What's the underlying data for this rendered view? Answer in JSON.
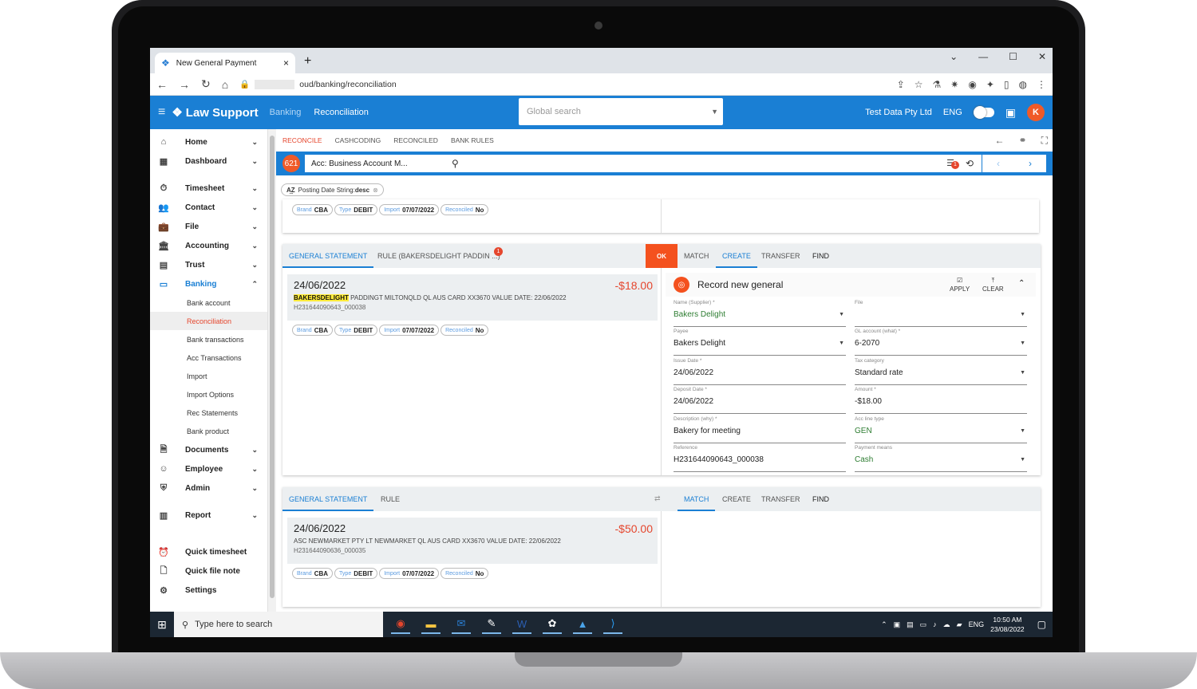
{
  "browser": {
    "tab_title": "New General Payment",
    "tab_close": "×",
    "new_tab": "+",
    "url_suffix": "oud/banking/reconciliation",
    "win_min": "—",
    "win_max": "☐",
    "win_close": "✕",
    "win_menu": "⌄"
  },
  "app": {
    "logo": "Law Support",
    "crumb_1": "Banking",
    "crumb_2": "Reconciliation",
    "global_search_placeholder": "Global search",
    "company": "Test Data Pty Ltd",
    "lang": "ENG",
    "avatar_letter": "K",
    "accent": "#1a7fd4",
    "alert": "#e5462d"
  },
  "sidebar": {
    "items": [
      {
        "label": "Home",
        "icon": "home-icon"
      },
      {
        "label": "Dashboard",
        "icon": "dashboard-icon"
      },
      {
        "label": "Timesheet",
        "icon": "stopwatch-icon"
      },
      {
        "label": "Contact",
        "icon": "people-icon"
      },
      {
        "label": "File",
        "icon": "briefcase-icon"
      },
      {
        "label": "Accounting",
        "icon": "bank-icon"
      },
      {
        "label": "Trust",
        "icon": "building-icon"
      },
      {
        "label": "Banking",
        "icon": "card-icon"
      }
    ],
    "banking_sub": [
      "Bank account",
      "Reconciliation",
      "Bank transactions",
      "Acc Transactions",
      "Import",
      "Import Options",
      "Rec Statements",
      "Bank product"
    ],
    "items_2": [
      {
        "label": "Documents"
      },
      {
        "label": "Employee"
      },
      {
        "label": "Admin"
      },
      {
        "label": "Report"
      },
      {
        "label": "Quick timesheet"
      },
      {
        "label": "Quick file note"
      },
      {
        "label": "Settings"
      }
    ]
  },
  "main": {
    "tabs": [
      "RECONCILE",
      "CASHCODING",
      "RECONCILED",
      "BANK RULES"
    ],
    "count": "621",
    "account": "Acc: Business Account M...",
    "filter_badge": "1",
    "sort_chip": "Posting Date String:",
    "sort_dir": "desc",
    "chips": {
      "brand_k": "Brand",
      "brand_v": "CBA",
      "type_k": "Type",
      "type_v": "DEBIT",
      "import_k": "Import",
      "import_v": "07/07/2022",
      "rec_k": "Reconciled",
      "rec_v": "No"
    },
    "card1": {
      "tab_statement": "GENERAL STATEMENT",
      "tab_rule": "RULE (BAKERSDELIGHT PADDIN ...)",
      "rule_badge": "1",
      "ok": "OK",
      "tab_match": "MATCH",
      "tab_create": "CREATE",
      "tab_transfer": "TRANSFER",
      "tab_find": "FIND",
      "date": "24/06/2022",
      "amount": "-$18.00",
      "highlight": "BAKERSDELIGHT",
      "desc": " PADDINGT MILTONQLD QL AUS CARD XX3670 VALUE DATE: 22/06/2022",
      "ref": "H231644090643_000038"
    },
    "form": {
      "title": "Record new general",
      "apply": "APPLY",
      "clear": "CLEAR",
      "fields": [
        {
          "label": "Name (Supplier) *",
          "value": "Bakers Delight"
        },
        {
          "label": "File",
          "value": ""
        },
        {
          "label": "Payee",
          "value": "Bakers Delight"
        },
        {
          "label": "GL account (what) *",
          "value": "6-2070"
        },
        {
          "label": "Issue Date *",
          "value": "24/06/2022"
        },
        {
          "label": "Tax category",
          "value": "Standard rate"
        },
        {
          "label": "Deposit Date *",
          "value": "24/06/2022"
        },
        {
          "label": "Amount *",
          "value": "-$18.00"
        },
        {
          "label": "Description (why) *",
          "value": "Bakery for meeting"
        },
        {
          "label": "Acc line type",
          "value": "GEN"
        },
        {
          "label": "Reference",
          "value": "H231644090643_000038"
        },
        {
          "label": "Payment means",
          "value": "Cash"
        }
      ]
    },
    "card2": {
      "tab_statement": "GENERAL STATEMENT",
      "tab_rule": "RULE",
      "tab_match": "MATCH",
      "tab_create": "CREATE",
      "tab_transfer": "TRANSFER",
      "tab_find": "FIND",
      "date": "24/06/2022",
      "amount": "-$50.00",
      "desc": "ASC NEWMARKET PTY LT NEWMARKET QL AUS CARD XX3670 VALUE DATE: 22/06/2022",
      "ref": "H231644090636_000035"
    }
  },
  "taskbar": {
    "search": "Type here to search",
    "lang": "ENG",
    "time": "10:50 AM",
    "date": "23/08/2022"
  }
}
